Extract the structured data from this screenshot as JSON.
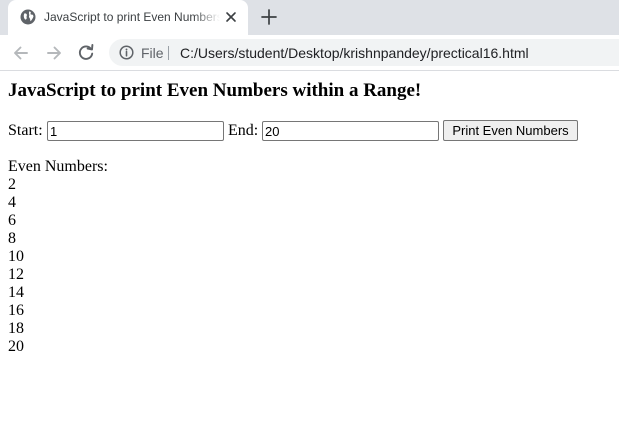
{
  "browser": {
    "tab": {
      "title": "JavaScript to print Even Numbers within a Range",
      "favicon": "globe-icon"
    },
    "toolbar": {
      "scheme_label": "File",
      "url": "C:/Users/student/Desktop/krishnpandey/prectical16.html"
    }
  },
  "page": {
    "title": "JavaScript to print Even Numbers within a Range!",
    "form": {
      "start_label": "Start:",
      "start_value": "1",
      "end_label": "End:",
      "end_value": "20",
      "button_label": "Print Even Numbers"
    },
    "result": {
      "heading": "Even Numbers:",
      "numbers": [
        "2",
        "4",
        "6",
        "8",
        "10",
        "12",
        "14",
        "16",
        "18",
        "20"
      ]
    }
  },
  "colors": {
    "tabstrip_bg": "#dee1e6",
    "omnibox_bg": "#f1f3f4",
    "button_bg": "#efefef",
    "text": "#000000"
  }
}
